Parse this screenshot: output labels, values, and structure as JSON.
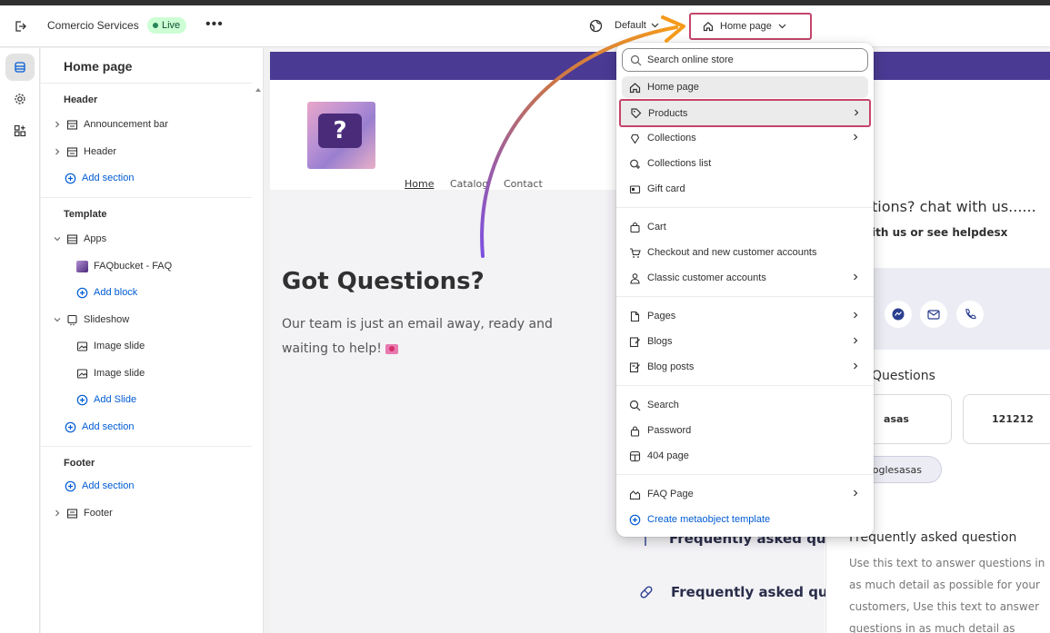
{
  "topbar": {
    "store_name": "Comercio Services",
    "status_badge": "Live",
    "more_label": "•••",
    "theme_selector": "Default",
    "page_selector": "Home page"
  },
  "sidebar": {
    "title": "Home page",
    "header_group": {
      "label": "Header",
      "items": [
        "Announcement bar",
        "Header"
      ],
      "add_section": "Add section"
    },
    "template_group": {
      "label": "Template",
      "apps_label": "Apps",
      "apps_child": "FAQbucket - FAQ",
      "add_block": "Add block",
      "slideshow_label": "Slideshow",
      "slides": [
        "Image slide",
        "Image slide"
      ],
      "add_slide": "Add Slide",
      "add_section": "Add section"
    },
    "footer_group": {
      "label": "Footer",
      "add_section": "Add section",
      "footer_item": "Footer"
    }
  },
  "dropdown": {
    "search_placeholder": "Search online store",
    "items": [
      {
        "label": "Home page",
        "icon": "home-icon",
        "arrow": false
      },
      {
        "label": "Products",
        "icon": "tag-icon",
        "arrow": true
      },
      {
        "label": "Collections",
        "icon": "collection-icon",
        "arrow": true
      },
      {
        "label": "Collections list",
        "icon": "collection-list-icon",
        "arrow": false
      },
      {
        "label": "Gift card",
        "icon": "gift-card-icon",
        "arrow": false
      },
      {
        "label": "Cart",
        "icon": "bag-icon",
        "arrow": false
      },
      {
        "label": "Checkout and new customer accounts",
        "icon": "cart-icon",
        "arrow": false
      },
      {
        "label": "Classic customer accounts",
        "icon": "person-icon",
        "arrow": true
      },
      {
        "label": "Pages",
        "icon": "page-icon",
        "arrow": true
      },
      {
        "label": "Blogs",
        "icon": "blog-icon",
        "arrow": true
      },
      {
        "label": "Blog posts",
        "icon": "blog-post-icon",
        "arrow": true
      },
      {
        "label": "Search",
        "icon": "search-icon",
        "arrow": false
      },
      {
        "label": "Password",
        "icon": "lock-icon",
        "arrow": false
      },
      {
        "label": "404 page",
        "icon": "404-icon",
        "arrow": false
      },
      {
        "label": "FAQ Page",
        "icon": "metaobject-icon",
        "arrow": true
      },
      {
        "label": "Create metaobject template",
        "icon": "plus-circle-icon",
        "arrow": false
      }
    ]
  },
  "preview": {
    "nav": [
      "Home",
      "Catalog",
      "Contact"
    ],
    "logo_glyph": "?",
    "heading": "Got Questions?",
    "body": "Our team is just an email away, ready and waiting to help!",
    "chat_title": "tions? chat with us......",
    "chat_sub": "ith us or see helpdesx",
    "questions_label": "Questions",
    "question_boxes": [
      "asas",
      "121212"
    ],
    "pill": "ooglesasas",
    "faq_rows": [
      "Frequently asked que",
      "Frequently asked que"
    ],
    "faq_card_title": "Frequently asked question",
    "faq_card_body": "Use this text to answer questions in as much detail as possible for your customers, Use this text to answer questions in as much detail as possible"
  },
  "colors": {
    "highlight_box": "#c4456b",
    "arrow_start": "#7b4fe0",
    "arrow_end": "#f59a1a",
    "announcement_bar": "#4b3a93",
    "link_blue": "#005bd3",
    "live_badge": "#cdfed4"
  }
}
